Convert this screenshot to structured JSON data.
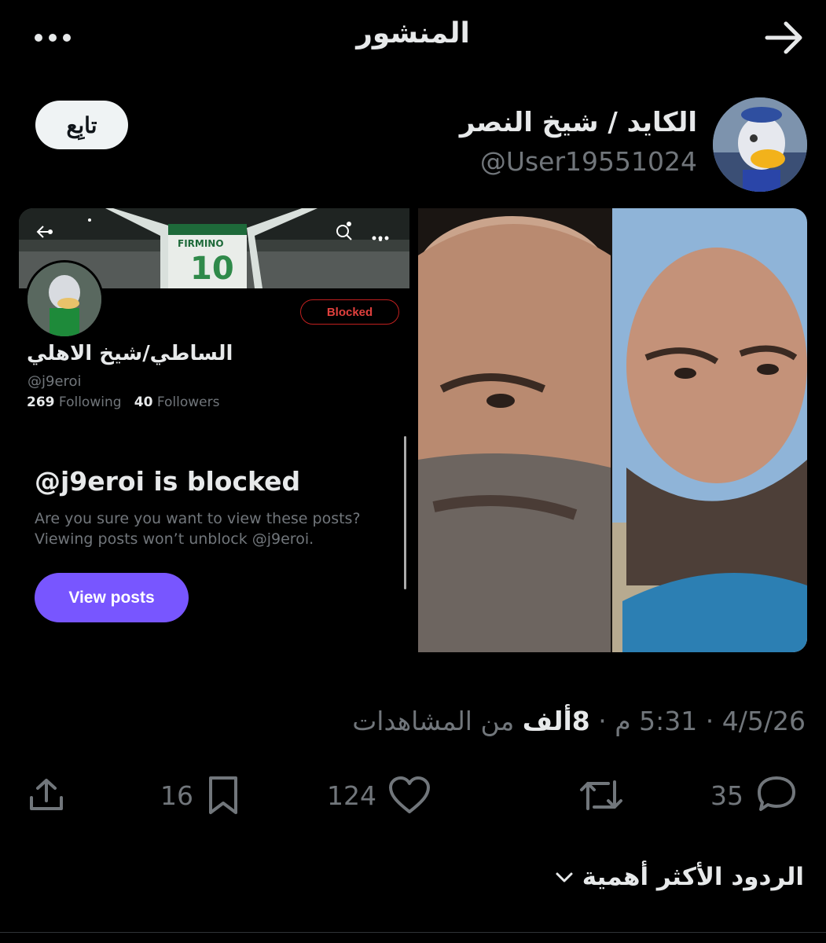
{
  "header": {
    "title": "المنشور",
    "more_icon": "more-horizontal-icon",
    "back_icon": "arrow-right-icon"
  },
  "author": {
    "name": "الكايد / شيخ النصر",
    "handle": "@User19551024",
    "follow_label": "تابِع"
  },
  "embedded_screenshot": {
    "profile_name": "الساطي/شيخ الاهلي",
    "profile_handle": "@j9eroi",
    "following_count": "269",
    "following_label": "Following",
    "followers_count": "40",
    "followers_label": "Followers",
    "blocked_button": "Blocked",
    "blocked_title": "@j9eroi is blocked",
    "blocked_text": "Are you sure you want to view these posts? Viewing posts won’t unblock @j9eroi.",
    "view_posts_button": "View posts",
    "banner_jersey_name": "FIRMINO",
    "banner_jersey_number": "10"
  },
  "meta": {
    "date": "4/5/26",
    "separator": "·",
    "time": "5:31 م",
    "views_count": "8ألف",
    "views_label": "من المشاهدات"
  },
  "actions": {
    "replies": "35",
    "reposts": "",
    "likes": "124",
    "bookmarks": "16"
  },
  "replies_sort": {
    "label": "الردود الأكثر أهمية"
  },
  "colors": {
    "background": "#000000",
    "text": "#e7e9ea",
    "muted": "#71767b",
    "accent": "#7856ff",
    "blocked": "#c0201f"
  }
}
